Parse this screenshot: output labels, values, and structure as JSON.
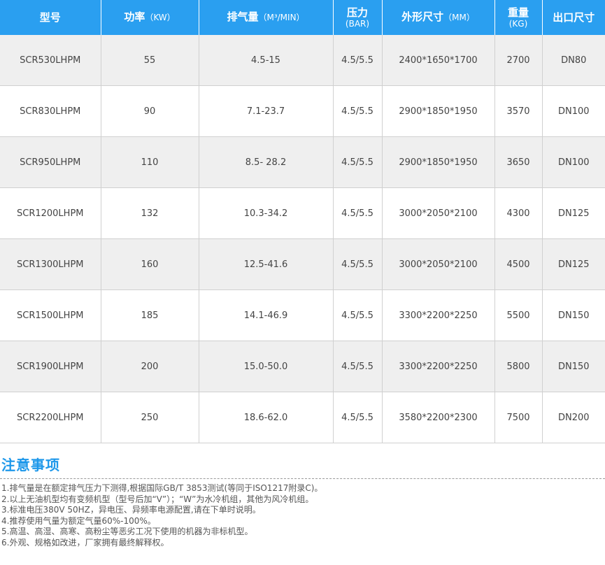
{
  "table": {
    "headers": [
      {
        "label": "型号",
        "unit": ""
      },
      {
        "label": "功率",
        "unit": "（KW）"
      },
      {
        "label": "排气量",
        "unit": "（M³/MIN）"
      },
      {
        "label": "压力",
        "unit": "(BAR)"
      },
      {
        "label": "外形尺寸",
        "unit": "（MM）"
      },
      {
        "label": "重量",
        "unit": "(KG)"
      },
      {
        "label": "出口尺寸",
        "unit": ""
      }
    ],
    "rows": [
      [
        "SCR530LHPM",
        "55",
        "4.5-15",
        "4.5/5.5",
        "2400*1650*1700",
        "2700",
        "DN80"
      ],
      [
        "SCR830LHPM",
        "90",
        "7.1-23.7",
        "4.5/5.5",
        "2900*1850*1950",
        "3570",
        "DN100"
      ],
      [
        "SCR950LHPM",
        "110",
        "8.5- 28.2",
        "4.5/5.5",
        "2900*1850*1950",
        "3650",
        "DN100"
      ],
      [
        "SCR1200LHPM",
        "132",
        "10.3-34.2",
        "4.5/5.5",
        "3000*2050*2100",
        "4300",
        "DN125"
      ],
      [
        "SCR1300LHPM",
        "160",
        "12.5-41.6",
        "4.5/5.5",
        "3000*2050*2100",
        "4500",
        "DN125"
      ],
      [
        "SCR1500LHPM",
        "185",
        "14.1-46.9",
        "4.5/5.5",
        "3300*2200*2250",
        "5500",
        "DN150"
      ],
      [
        "SCR1900LHPM",
        "200",
        "15.0-50.0",
        "4.5/5.5",
        "3300*2200*2250",
        "5800",
        "DN150"
      ],
      [
        "SCR2200LHPM",
        "250",
        "18.6-62.0",
        "4.5/5.5",
        "3580*2200*2300",
        "7500",
        "DN200"
      ]
    ]
  },
  "notes": {
    "title": "注意事项",
    "items": [
      "1.排气量是在额定排气压力下测得,根据国际GB/T 3853测试(等同于ISO1217附录C)。",
      "2.以上无油机型均有变频机型（型号后加“V”）；“W”为水冷机组，其他为风冷机组。",
      "3.标准电压380V 50HZ，异电压、异频率电源配置,请在下单时说明。",
      "4.推荐使用气量为额定气量60%-100%。",
      "5.高温、高湿、高寒、高粉尘等恶劣工况下使用的机器为非标机型。",
      "6.外观、规格如改进，厂家拥有最终解释权。"
    ]
  },
  "colors": {
    "header_bg": "#2a9ff0",
    "title_blue": "#1e98ea",
    "row_alt_bg": "#efefef"
  }
}
